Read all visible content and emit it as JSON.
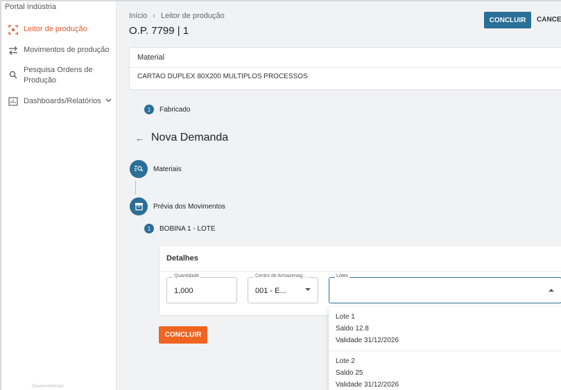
{
  "sidebar": {
    "brand": "Portal Indústria",
    "items": [
      {
        "label": "Leitor de produção",
        "icon": "scan-icon",
        "active": true
      },
      {
        "label": "Movimentos de produção",
        "icon": "swap-icon"
      },
      {
        "label": "Pesquisa Ordens de",
        "label2": "Produção",
        "icon": "search-icon"
      },
      {
        "label": "Dashboards/Relatórios",
        "icon": "dashboard-icon"
      }
    ],
    "footer": "Desenvolvido por"
  },
  "header": {
    "breadcrumb": [
      "Início",
      "Leitor de produção"
    ],
    "title": "O.P. 7799 | 1",
    "concluir": "CONCLUIR",
    "cancel": "CANCEL"
  },
  "material": {
    "label": "Material",
    "value": "CARTAO DUPLEX 80X200 MULTIPLOS PROCESSOS"
  },
  "fabricado": {
    "num": "1",
    "label": "Fabricado"
  },
  "demanda": {
    "title": "Nova Demanda"
  },
  "steps": {
    "materiais": "Materiais",
    "previa": "Prévia dos Movimentos"
  },
  "bobina": {
    "num": "1",
    "label": "BOBINA 1 - LOTE"
  },
  "detalhes": {
    "title": "Detalhes",
    "quantidade": {
      "label": "Quantidade",
      "value": "1,000"
    },
    "centro": {
      "label": "Centro de Armazenag...",
      "value": "001 - E..."
    },
    "lotes": {
      "label": "Lotes",
      "value": ""
    }
  },
  "concluir_label": "CONCLUIR",
  "lote_options": [
    {
      "name": "Lote 1",
      "saldo": "Saldo 12.8",
      "validade": "Validade 31/12/2026"
    },
    {
      "name": "Lote 2",
      "saldo": "Saldo 25",
      "validade": "Validade 31/12/2026"
    }
  ],
  "colors": {
    "primary": "#2a6f97",
    "accent": "#f06421",
    "active": "#e4572e"
  }
}
